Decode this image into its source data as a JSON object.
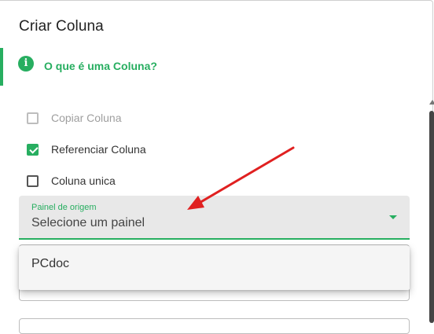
{
  "dialog": {
    "title": "Criar Coluna",
    "info_link": "O que é uma Coluna?",
    "info_icon": "info-icon",
    "accent_color": "#27ae60"
  },
  "options": [
    {
      "label": "Copiar Coluna",
      "checked": false,
      "disabled": true
    },
    {
      "label": "Referenciar Coluna",
      "checked": true,
      "disabled": false
    },
    {
      "label": "Coluna unica",
      "checked": false,
      "disabled": false
    }
  ],
  "origin_panel": {
    "label": "Painel de origem",
    "placeholder": "Selecione um painel",
    "options": [
      "PCdoc"
    ]
  },
  "annotation": {
    "color": "#e02020"
  }
}
